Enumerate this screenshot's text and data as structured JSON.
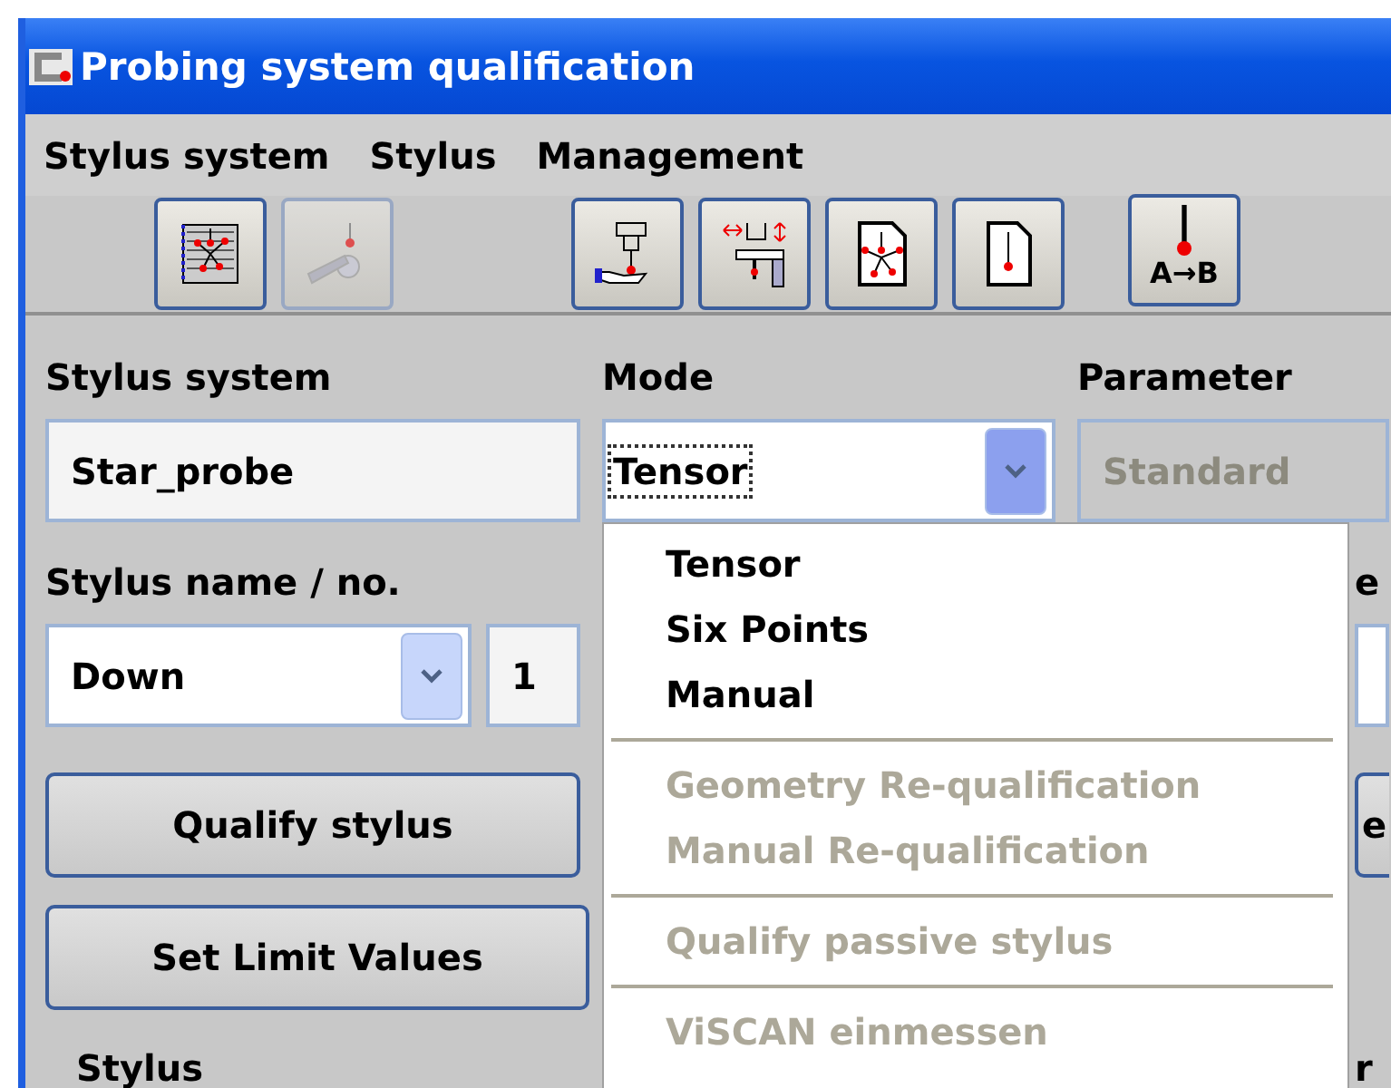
{
  "window": {
    "title": "Probing system qualification"
  },
  "menu": [
    "Stylus system",
    "Stylus",
    "Management"
  ],
  "toolbar": [
    {
      "buttons": [
        {
          "kind": "stylus-sheet",
          "disabled": false
        },
        {
          "kind": "probe-arm",
          "disabled": true
        }
      ]
    },
    {
      "buttons": [
        {
          "kind": "hand-probe",
          "disabled": false
        },
        {
          "kind": "measure",
          "disabled": false
        },
        {
          "kind": "doc-star",
          "disabled": false
        },
        {
          "kind": "doc-stylus",
          "disabled": false
        }
      ]
    },
    {
      "buttons": [
        {
          "kind": "a-to-b",
          "disabled": false,
          "label": "A→B"
        }
      ]
    }
  ],
  "stylus_system": {
    "label": "Stylus system",
    "value": "Star_probe"
  },
  "mode": {
    "label": "Mode",
    "value": "Tensor",
    "open": true,
    "options": [
      {
        "kind": "item",
        "label": "Tensor",
        "disabled": false
      },
      {
        "kind": "item",
        "label": "Six Points",
        "disabled": false
      },
      {
        "kind": "item",
        "label": "Manual",
        "disabled": false
      },
      {
        "kind": "separator"
      },
      {
        "kind": "item",
        "label": "Geometry Re-qualification",
        "disabled": true
      },
      {
        "kind": "item",
        "label": "Manual Re-qualification",
        "disabled": true
      },
      {
        "kind": "separator"
      },
      {
        "kind": "item",
        "label": "Qualify passive stylus",
        "disabled": true
      },
      {
        "kind": "separator"
      },
      {
        "kind": "item",
        "label": "ViSCAN einmessen",
        "disabled": true
      }
    ]
  },
  "parameter": {
    "label": "Parameter",
    "value": "Standard",
    "disabled": true
  },
  "stylus_name": {
    "label": "Stylus name / no.",
    "value": "Down",
    "number": "1",
    "open": false
  },
  "buttons": [
    "Qualify stylus",
    "Set Limit Values"
  ],
  "group_box": {
    "label": "Stylus"
  },
  "column_3": {
    "label": "e",
    "button": "e",
    "group_label": "r"
  }
}
